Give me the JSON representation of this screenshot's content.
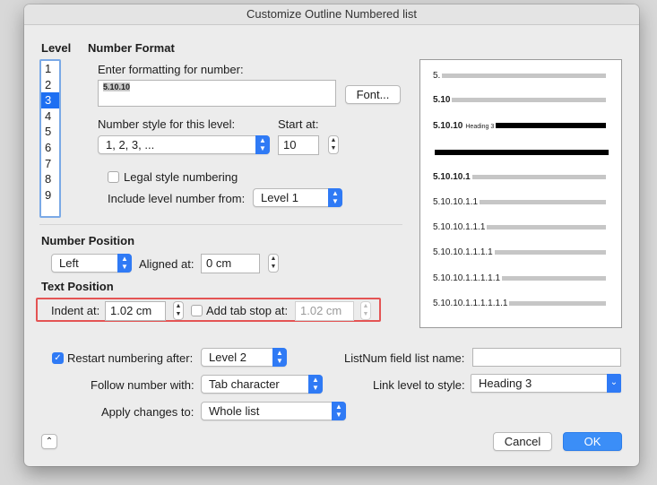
{
  "dialog": {
    "title": "Customize Outline Numbered list"
  },
  "level": {
    "heading": "Level",
    "items": [
      "1",
      "2",
      "3",
      "4",
      "5",
      "6",
      "7",
      "8",
      "9"
    ],
    "selected_index": 2
  },
  "number_format": {
    "heading": "Number Format",
    "enter_label": "Enter formatting for number:",
    "format_value": "5.10.10",
    "font_button": "Font...",
    "style_label": "Number style for this level:",
    "style_value": "1, 2, 3, ...",
    "start_label": "Start at:",
    "start_value": "10",
    "legal_label": "Legal style numbering",
    "legal_checked": false,
    "include_label": "Include level number from:",
    "include_value": "Level 1"
  },
  "preview": {
    "rows": [
      {
        "text": "5.",
        "bold": false
      },
      {
        "text": "5.10",
        "bold": true
      },
      {
        "text": "5.10.10",
        "bold": true,
        "suffix": "Heading 3"
      },
      {
        "text": "",
        "bold": true
      },
      {
        "text": "5.10.10.1",
        "bold": true
      },
      {
        "text": "5.10.10.1.1",
        "bold": false
      },
      {
        "text": "5.10.10.1.1.1",
        "bold": false
      },
      {
        "text": "5.10.10.1.1.1.1",
        "bold": false
      },
      {
        "text": "5.10.10.1.1.1.1.1",
        "bold": false
      },
      {
        "text": "5.10.10.1.1.1.1.1.1",
        "bold": false
      }
    ]
  },
  "number_position": {
    "heading": "Number Position",
    "align_value": "Left",
    "aligned_label": "Aligned at:",
    "aligned_value": "0 cm"
  },
  "text_position": {
    "heading": "Text Position",
    "indent_label": "Indent at:",
    "indent_value": "1.02 cm",
    "tab_label": "Add tab stop at:",
    "tab_value": "1.02 cm",
    "tab_checked": false
  },
  "options": {
    "restart_label": "Restart numbering after:",
    "restart_checked": true,
    "restart_value": "Level 2",
    "follow_label": "Follow number with:",
    "follow_value": "Tab character",
    "apply_label": "Apply changes to:",
    "apply_value": "Whole list",
    "listnum_label": "ListNum field list name:",
    "listnum_value": "",
    "link_label": "Link level to style:",
    "link_value": "Heading 3"
  },
  "footer": {
    "cancel": "Cancel",
    "ok": "OK"
  },
  "colors": {
    "accent": "#2f7af5",
    "highlight": "#e45454"
  }
}
